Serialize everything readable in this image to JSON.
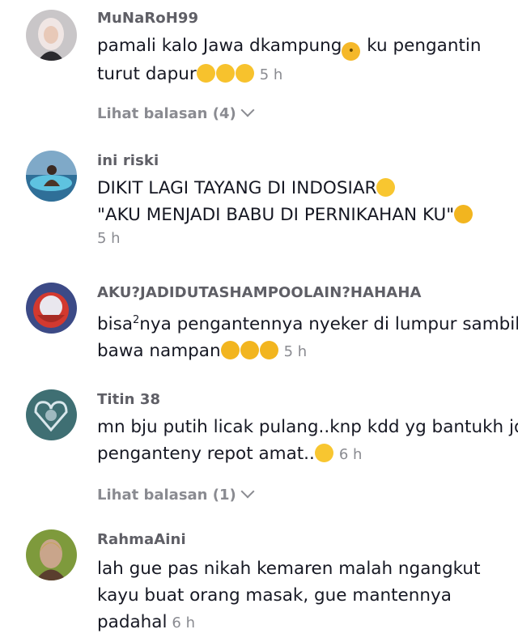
{
  "comments": [
    {
      "username": "MuNaRoH99",
      "line1": "pamali kalo Jawa dkampung",
      "line1b": " ku pengantin",
      "line2": "turut dapur",
      "time": "5 h",
      "replies": "Lihat balasan (4)"
    },
    {
      "username": "ini riski",
      "line1": "DIKIT LAGI TAYANG DI INDOSIAR",
      "line2": "\"AKU MENJADI BABU DI PERNIKAHAN KU\"",
      "time": "5 h"
    },
    {
      "username": "AKU?JADIDUTASHAMPOOLAIN?HAHAHA",
      "line1a": "bisa",
      "line1sup": "2",
      "line1b": "nya pengantennya nyeker di lumpur sambil",
      "line2": "bawa nampan",
      "time": "5 h"
    },
    {
      "username": "Titin 38",
      "line1": "mn bju putih licak pulang..knp kdd yg bantukh jd",
      "line2": "penganteny repot amat..",
      "time": "6 h",
      "replies": "Lihat balasan (1)"
    },
    {
      "username": "RahmaAini",
      "line1": "lah gue pas nikah kemaren malah ngangkut",
      "line2": "kayu buat orang masak, gue mantennya",
      "line3": "padahal",
      "time": "6 h"
    }
  ],
  "icons": {
    "thinking": "thinking-face-icon",
    "sweat_smile": "grinning-sweat-icon",
    "joy": "tears-of-joy-icon",
    "crying": "loudly-crying-icon",
    "chevron": "chevron-down-icon"
  },
  "colors": {
    "username": "#5f5f66",
    "text": "#161823",
    "meta": "#8a8b91",
    "emoji": "#f7c22d"
  }
}
